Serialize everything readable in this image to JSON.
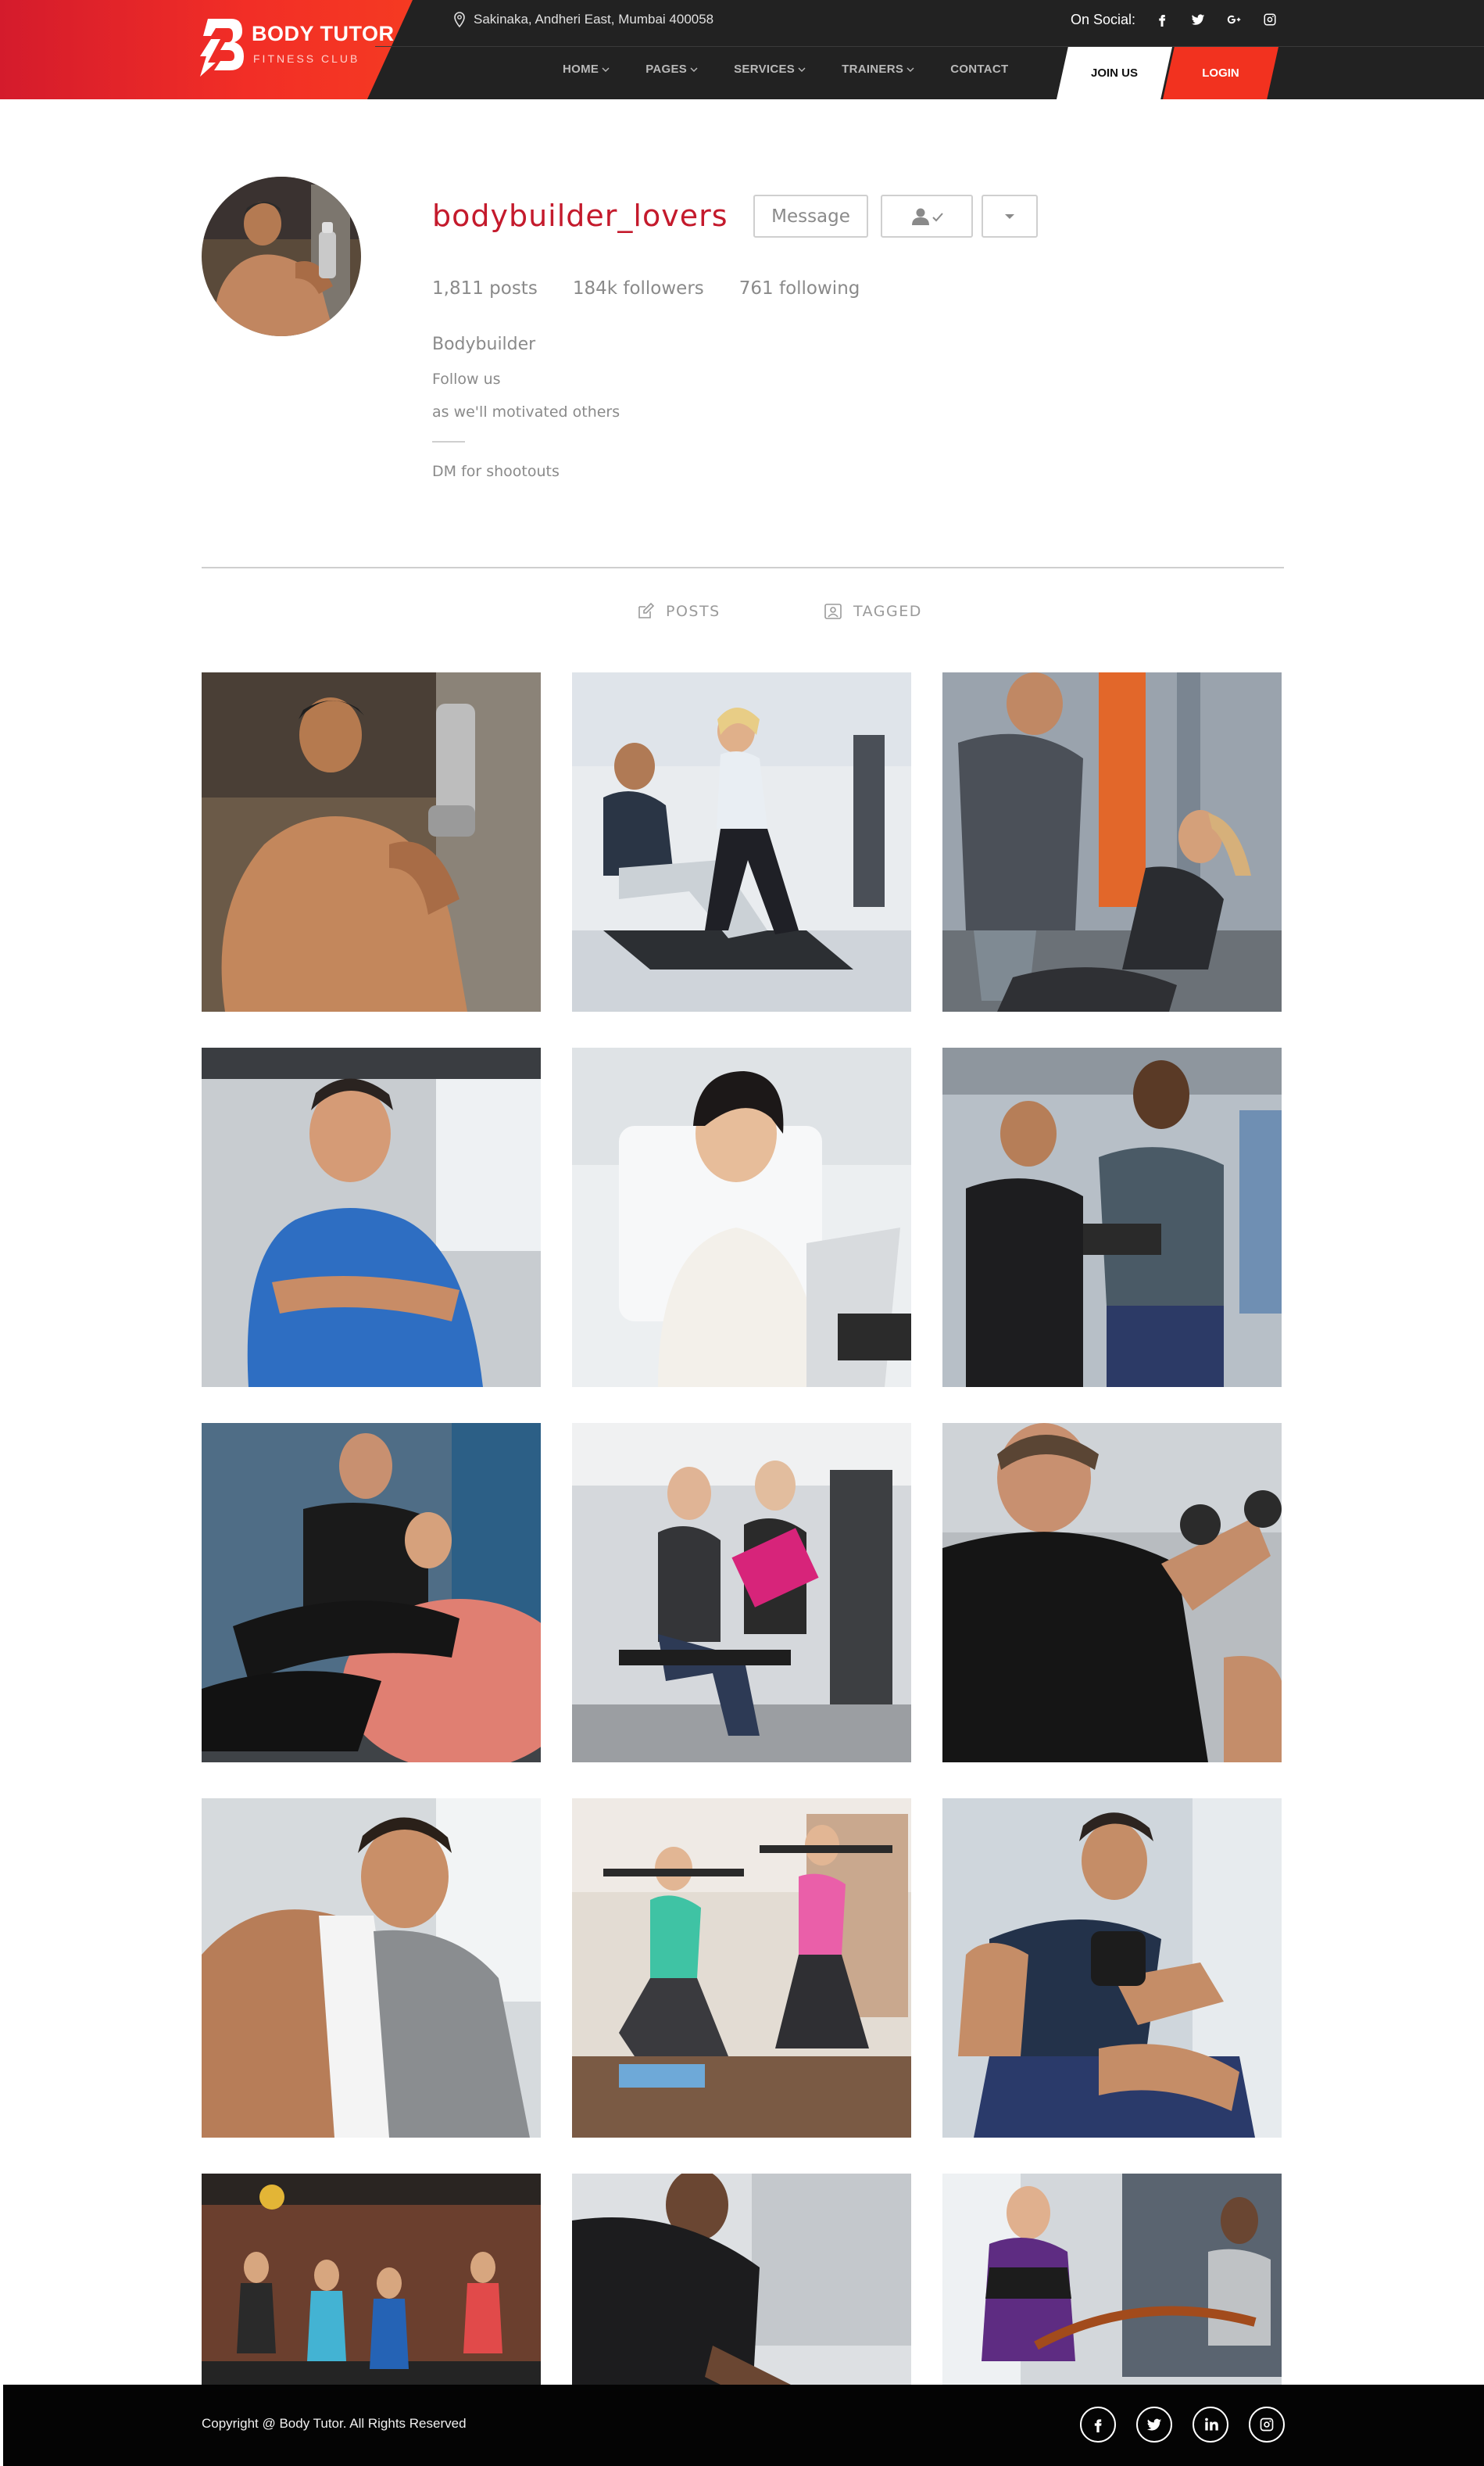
{
  "brand": {
    "title": "BODY TUTOR",
    "subtitle": "FITNESS CLUB",
    "colors": {
      "accent": "#f2321f",
      "header": "#222222",
      "username": "#c41a2c"
    }
  },
  "topbar": {
    "address": "Sakinaka, Andheri East, Mumbai 400058",
    "social_label": "On Social:",
    "social_icons": [
      "facebook-icon",
      "twitter-icon",
      "google-plus-icon",
      "instagram-icon"
    ]
  },
  "nav": {
    "items": [
      {
        "label": "HOME",
        "dropdown": true
      },
      {
        "label": "PAGES",
        "dropdown": true
      },
      {
        "label": "SERVICES",
        "dropdown": true
      },
      {
        "label": "TRAINERS",
        "dropdown": true
      },
      {
        "label": "CONTACT",
        "dropdown": false
      }
    ],
    "join_label": "JOIN US",
    "login_label": "LOGIN"
  },
  "profile": {
    "username": "bodybuilder_lovers",
    "message_label": "Message",
    "follow_icon": "user-check-icon",
    "more_icon": "caret-down-icon",
    "stats": {
      "posts": "1,811 posts",
      "followers": "184k followers",
      "following": "761 following"
    },
    "bio": {
      "name": "Bodybuilder",
      "line1": "Follow us",
      "line2": "as we'll motivated others",
      "line3": "DM for shootouts"
    }
  },
  "tabs": {
    "posts": "POSTS",
    "tagged": "TAGGED"
  },
  "posts": [
    {
      "alt": "Bodybuilder holding chain"
    },
    {
      "alt": "Couple on rowing machines"
    },
    {
      "alt": "Personal trainer with woman doing sit-ups"
    },
    {
      "alt": "Man in blue t-shirt with crossed arms"
    },
    {
      "alt": "Smiling woman at laptop"
    },
    {
      "alt": "Trainer with clipboard and client"
    },
    {
      "alt": "Trainer assisting woman on exercise ball"
    },
    {
      "alt": "Women talking with pink folder in gym"
    },
    {
      "alt": "Personal trainer lifting dumbbell"
    },
    {
      "alt": "Man with towel in gym"
    },
    {
      "alt": "Women doing lunges with barbells"
    },
    {
      "alt": "Man doing dumbbell curl"
    },
    {
      "alt": "Group kettlebell class"
    },
    {
      "alt": "Trainer helping client stretch"
    },
    {
      "alt": "Trainer with battle ropes"
    }
  ],
  "footer": {
    "copyright": "Copyright @ Body Tutor. All Rights Reserved",
    "social_icons": [
      "facebook-icon",
      "twitter-icon",
      "linkedin-icon",
      "instagram-icon"
    ]
  }
}
